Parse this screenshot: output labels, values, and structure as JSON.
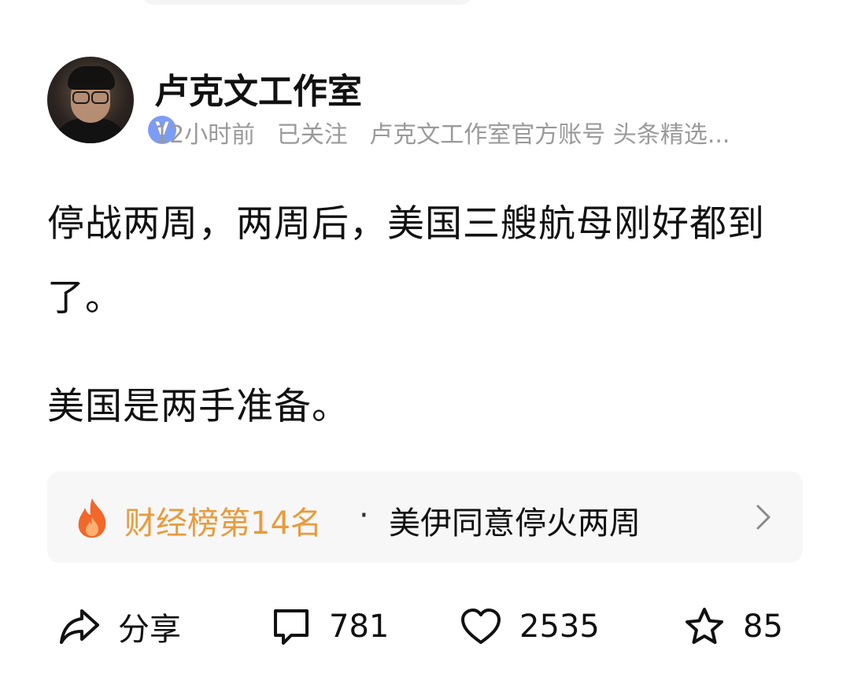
{
  "author": {
    "name": "卢克文工作室",
    "verified_badge": "V",
    "meta": {
      "time": "12小时前",
      "follow_status": "已关注",
      "description": "卢克文工作室官方账号 头条精选..."
    }
  },
  "post": {
    "paragraphs": [
      "停战两周，两周后，美国三艘航母刚好都到了。",
      "美国是两手准备。"
    ]
  },
  "hot_topic": {
    "icon": "flame-icon",
    "rank_label": "财经榜第14名",
    "separator": "·",
    "title": "美伊同意停火两周",
    "accent_color": "#e99b3c"
  },
  "actions": {
    "share_label": "分享",
    "comment_count": "781",
    "like_count": "2535",
    "favorite_count": "85"
  },
  "colors": {
    "verified_badge": "#7d9cf3",
    "meta_text": "#9a9a9a",
    "flame": "#f2672a"
  }
}
